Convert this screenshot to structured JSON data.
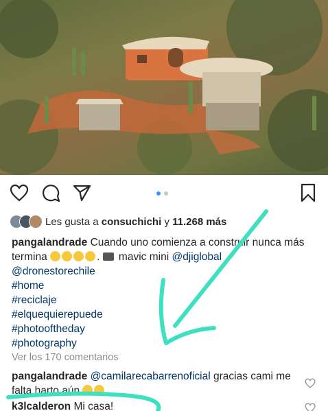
{
  "post": {
    "carousel": {
      "count": 2,
      "active": 0
    },
    "likes": {
      "prefix": "Les gusta a",
      "user": "consuchichi",
      "connector": "y",
      "count": "11.268 más"
    },
    "caption": {
      "user": "pangalandrade",
      "text_1": "Cuando uno comienza a construir nunca más termina",
      "text_2": ". ",
      "text_3": " mavic mini ",
      "mention_1": "@djiglobal",
      "mention_2": "@dronestorechile",
      "hashtags": [
        "#home",
        "#reciclaje",
        "#elquequierepuede",
        "#photooftheday",
        "#photography"
      ]
    },
    "view_comments": "Ver los 170 comentarios",
    "comments": [
      {
        "user": "pangalandrade",
        "mention": "@camilarecabarrenoficial",
        "text": " gracias cami me falta harto aún "
      },
      {
        "user": "k3lcalderon",
        "mention": "",
        "text": " Mi casa!"
      }
    ],
    "icons": {
      "like": "heart-icon",
      "comment": "comment-bubble-icon",
      "share": "paper-plane-icon",
      "save": "bookmark-icon"
    },
    "annotation_color": "#3fe0c0"
  }
}
